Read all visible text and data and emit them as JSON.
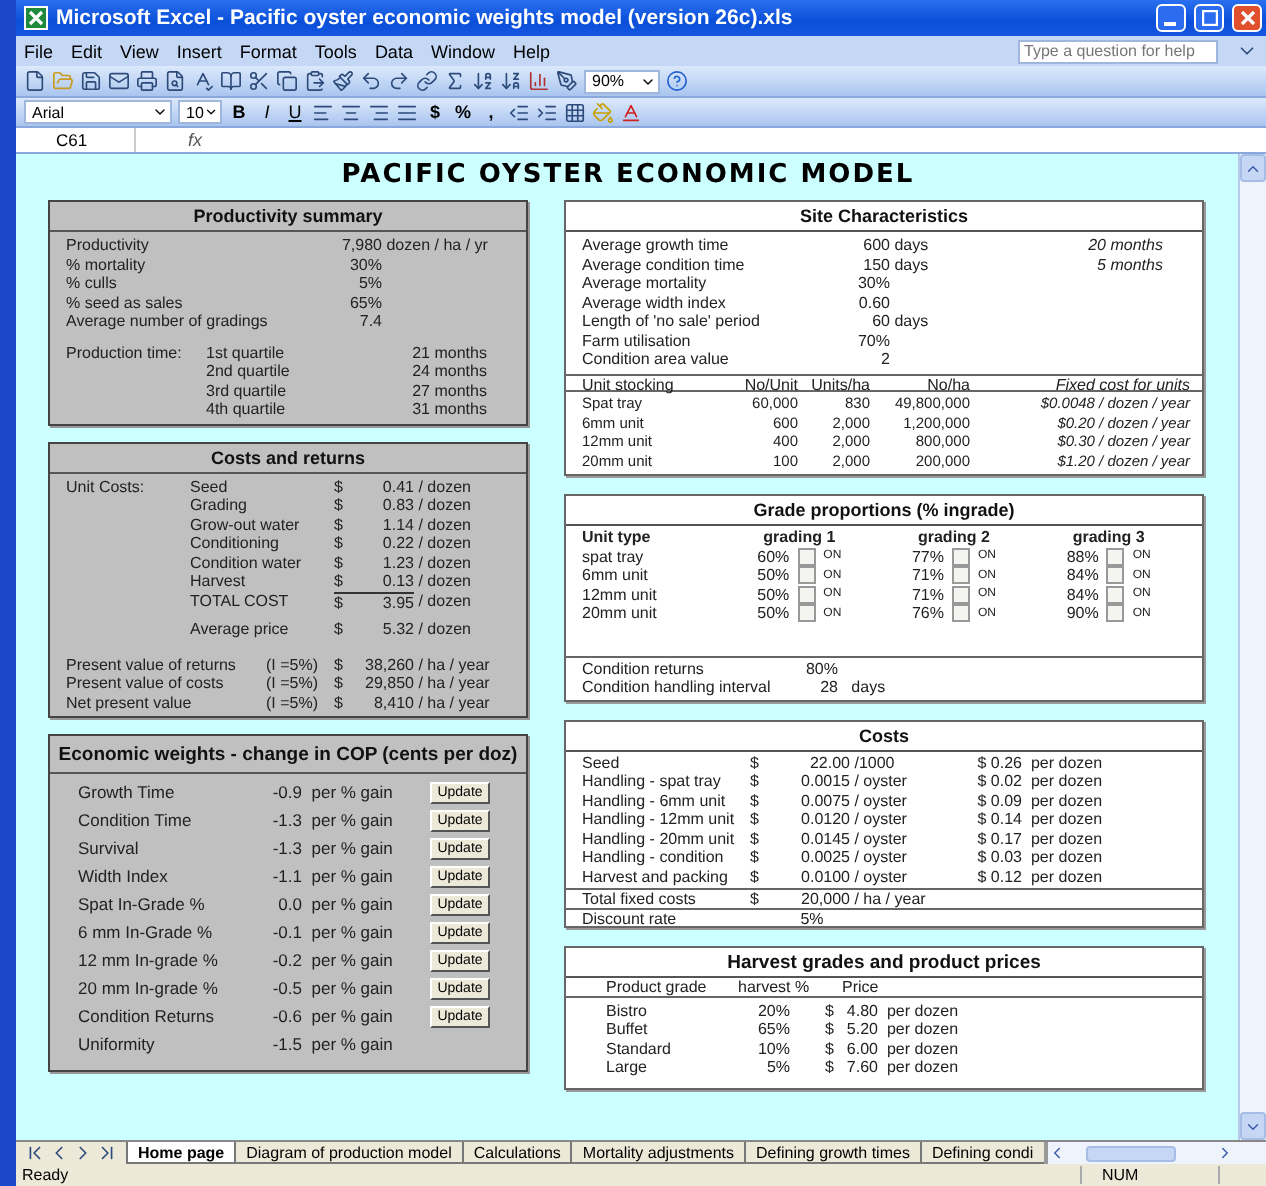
{
  "window": {
    "title": "Microsoft Excel - Pacific oyster economic weights model (version 26c).xls"
  },
  "menu": [
    "File",
    "Edit",
    "View",
    "Insert",
    "Format",
    "Tools",
    "Data",
    "Window",
    "Help"
  ],
  "help_box": {
    "placeholder": "Type a question for help"
  },
  "toolbar": {
    "zoom": "90%"
  },
  "format_bar": {
    "font": "Arial",
    "size": "10",
    "style_buttons": [
      "B",
      "I",
      "U"
    ],
    "number_buttons": [
      "$",
      "%",
      ","
    ]
  },
  "formula_bar": {
    "name_box": "C61",
    "fx": "fx"
  },
  "sheet_title": "PACIFIC OYSTER ECONOMIC MODEL",
  "productivity_summary": {
    "title": "Productivity summary",
    "rows": [
      {
        "label": "Productivity",
        "value": "7,980",
        "unit": "dozen / ha / yr"
      },
      {
        "label": "% mortality",
        "value": "30%"
      },
      {
        "label": "% culls",
        "value": "5%"
      },
      {
        "label": "% seed as sales",
        "value": "65%"
      },
      {
        "label": "Average number of gradings",
        "value": "7.4"
      }
    ],
    "production_time": {
      "label": "Production time:",
      "rows": [
        {
          "quartile": "1st quartile",
          "value": "21",
          "unit": "months"
        },
        {
          "quartile": "2nd quartile",
          "value": "24",
          "unit": "months"
        },
        {
          "quartile": "3rd quartile",
          "value": "27",
          "unit": "months"
        },
        {
          "quartile": "4th quartile",
          "value": "31",
          "unit": "months"
        }
      ]
    }
  },
  "costs_and_returns": {
    "title": "Costs and returns",
    "unit_costs_label": "Unit Costs:",
    "items": [
      {
        "kind": "item",
        "label": "Seed",
        "currency": "$",
        "value": "0.41",
        "unit": "/ dozen"
      },
      {
        "kind": "item",
        "label": "Grading",
        "currency": "$",
        "value": "0.83",
        "unit": "/ dozen"
      },
      {
        "kind": "item",
        "label": "Grow-out water",
        "currency": "$",
        "value": "1.14",
        "unit": "/ dozen"
      },
      {
        "kind": "item",
        "label": "Conditioning",
        "currency": "$",
        "value": "0.22",
        "unit": "/ dozen"
      },
      {
        "kind": "item",
        "label": "Condition water",
        "currency": "$",
        "value": "1.23",
        "unit": "/ dozen"
      },
      {
        "kind": "item",
        "label": "Harvest",
        "currency": "$",
        "value": "0.13",
        "unit": "/ dozen"
      },
      {
        "kind": "total",
        "label": "TOTAL COST",
        "currency": "$",
        "value": "3.95",
        "unit": "/ dozen"
      },
      {
        "kind": "price",
        "label": "Average price",
        "currency": "$",
        "value": "5.32",
        "unit": "/ dozen"
      }
    ],
    "present_values": [
      {
        "label": "Present value of returns",
        "rate": "(I =5%)",
        "currency": "$",
        "value": "38,260",
        "unit": "/ ha / year"
      },
      {
        "label": "Present value of costs",
        "rate": "(I =5%)",
        "currency": "$",
        "value": "29,850",
        "unit": "/ ha / year"
      },
      {
        "label": "Net present value",
        "rate": "(I =5%)",
        "currency": "$",
        "value": "8,410",
        "unit": "/ ha / year"
      }
    ]
  },
  "economic_weights": {
    "title": "Economic weights - change in COP (cents per doz)",
    "rows": [
      {
        "label": "Growth Time",
        "value": "-0.9",
        "unit": "per % gain",
        "button": "Update"
      },
      {
        "label": "Condition Time",
        "value": "-1.3",
        "unit": "per % gain",
        "button": "Update"
      },
      {
        "label": "Survival",
        "value": "-1.3",
        "unit": "per % gain",
        "button": "Update"
      },
      {
        "label": "Width Index",
        "value": "-1.1",
        "unit": "per % gain",
        "button": "Update"
      },
      {
        "label": "Spat In-Grade %",
        "value": "0.0",
        "unit": "per % gain",
        "button": "Update"
      },
      {
        "label": "6 mm In-Grade %",
        "value": "-0.1",
        "unit": "per % gain",
        "button": "Update"
      },
      {
        "label": "12 mm In-grade %",
        "value": "-0.2",
        "unit": "per % gain",
        "button": "Update"
      },
      {
        "label": "20 mm In-grade %",
        "value": "-0.5",
        "unit": "per % gain",
        "button": "Update"
      },
      {
        "label": "Condition Returns",
        "value": "-0.6",
        "unit": "per % gain",
        "button": "Update"
      },
      {
        "label": "Uniformity",
        "value": "-1.5",
        "unit": "per % gain"
      }
    ]
  },
  "site_characteristics": {
    "title": "Site Characteristics",
    "rows": [
      {
        "label": "Average growth time",
        "value": "600",
        "unit": "days",
        "alt_value": "20",
        "alt_unit": "months"
      },
      {
        "label": "Average condition time",
        "value": "150",
        "unit": "days",
        "alt_value": "5",
        "alt_unit": "months"
      },
      {
        "label": "Average mortality",
        "value": "30%"
      },
      {
        "label": "Average width index",
        "value": "0.60"
      },
      {
        "label": "Length of 'no sale' period",
        "value": "60",
        "unit": "days"
      },
      {
        "label": "Farm utilisation",
        "value": "70%"
      },
      {
        "label": "Condition area value",
        "value": "2"
      }
    ],
    "stocking": {
      "columns": [
        "Unit stocking",
        "No/Unit",
        "Units/ha",
        "No/ha",
        "Fixed cost for units"
      ],
      "rows": [
        [
          "Spat tray",
          "60,000",
          "830",
          "49,800,000",
          "$0.0048 / dozen / year"
        ],
        [
          "6mm unit",
          "600",
          "2,000",
          "1,200,000",
          "$0.20 / dozen / year"
        ],
        [
          "12mm unit",
          "400",
          "2,000",
          "800,000",
          "$0.30 / dozen / year"
        ],
        [
          "20mm unit",
          "100",
          "2,000",
          "200,000",
          "$1.20 / dozen / year"
        ]
      ]
    }
  },
  "grade_proportions": {
    "title": "Grade proportions (% ingrade)",
    "columns": [
      "Unit type",
      "grading 1",
      "grading 2",
      "grading 3"
    ],
    "rows": [
      {
        "unit": "spat tray",
        "gradings": [
          {
            "value": "60%",
            "label": "ON",
            "checked": false
          },
          {
            "value": "77%",
            "label": "ON",
            "checked": false
          },
          {
            "value": "88%",
            "label": "ON",
            "checked": false
          }
        ]
      },
      {
        "unit": "6mm unit",
        "gradings": [
          {
            "value": "50%",
            "label": "ON",
            "checked": false
          },
          {
            "value": "71%",
            "label": "ON",
            "checked": false
          },
          {
            "value": "84%",
            "label": "ON",
            "checked": false
          }
        ]
      },
      {
        "unit": "12mm unit",
        "gradings": [
          {
            "value": "50%",
            "label": "ON",
            "checked": false
          },
          {
            "value": "71%",
            "label": "ON",
            "checked": false
          },
          {
            "value": "84%",
            "label": "ON",
            "checked": false
          }
        ]
      },
      {
        "unit": "20mm unit",
        "gradings": [
          {
            "value": "50%",
            "label": "ON",
            "checked": false
          },
          {
            "value": "76%",
            "label": "ON",
            "checked": false
          },
          {
            "value": "90%",
            "label": "ON",
            "checked": false
          }
        ]
      }
    ],
    "condition": [
      {
        "label": "Condition returns",
        "value": "80%"
      },
      {
        "label": "Condition handling interval",
        "value": "28",
        "unit": "days"
      }
    ]
  },
  "costs": {
    "title": "Costs",
    "rows": [
      {
        "label": "Seed",
        "currency": "$",
        "value": "22.00",
        "unit": "/1000",
        "per_dozen": "$ 0.26",
        "per_unit": "per dozen"
      },
      {
        "label": "Handling - spat tray",
        "currency": "$",
        "value": "0.0015",
        "unit": "/ oyster",
        "per_dozen": "$ 0.02",
        "per_unit": "per dozen"
      },
      {
        "label": "Handling - 6mm unit",
        "currency": "$",
        "value": "0.0075",
        "unit": "/ oyster",
        "per_dozen": "$ 0.09",
        "per_unit": "per dozen"
      },
      {
        "label": "Handling - 12mm unit",
        "currency": "$",
        "value": "0.0120",
        "unit": "/ oyster",
        "per_dozen": "$ 0.14",
        "per_unit": "per dozen"
      },
      {
        "label": "Handling - 20mm unit",
        "currency": "$",
        "value": "0.0145",
        "unit": "/ oyster",
        "per_dozen": "$ 0.17",
        "per_unit": "per dozen"
      },
      {
        "label": "Handling - condition",
        "currency": "$",
        "value": "0.0025",
        "unit": "/ oyster",
        "per_dozen": "$ 0.03",
        "per_unit": "per dozen"
      },
      {
        "label": "Harvest and packing",
        "currency": "$",
        "value": "0.0100",
        "unit": "/ oyster",
        "per_dozen": "$ 0.12",
        "per_unit": "per dozen"
      }
    ],
    "totals": [
      {
        "label": "Total fixed costs",
        "currency": "$",
        "value": "20,000",
        "unit": "/ ha / year"
      },
      {
        "label": "Discount rate",
        "value": "5%"
      }
    ]
  },
  "harvest_grades": {
    "title": "Harvest grades and product prices",
    "columns": [
      "Product grade",
      "harvest %",
      "Price"
    ],
    "rows": [
      {
        "grade": "Bistro",
        "harvest": "20%",
        "currency": "$",
        "price": "4.80",
        "unit": "per dozen"
      },
      {
        "grade": "Buffet",
        "harvest": "65%",
        "currency": "$",
        "price": "5.20",
        "unit": "per dozen"
      },
      {
        "grade": "Standard",
        "harvest": "10%",
        "currency": "$",
        "price": "6.00",
        "unit": "per dozen"
      },
      {
        "grade": "Large",
        "harvest": "5%",
        "currency": "$",
        "price": "7.60",
        "unit": "per dozen"
      }
    ]
  },
  "sheet_tabs": [
    {
      "label": "Home page",
      "selected": true
    },
    {
      "label": "Diagram of production model",
      "selected": false
    },
    {
      "label": "Calculations",
      "selected": false
    },
    {
      "label": "Mortality adjustments",
      "selected": false
    },
    {
      "label": "Defining growth times",
      "selected": false
    },
    {
      "label": "Defining condi",
      "selected": false
    }
  ],
  "status_bar": {
    "status": "Ready",
    "num_lock": "NUM"
  }
}
